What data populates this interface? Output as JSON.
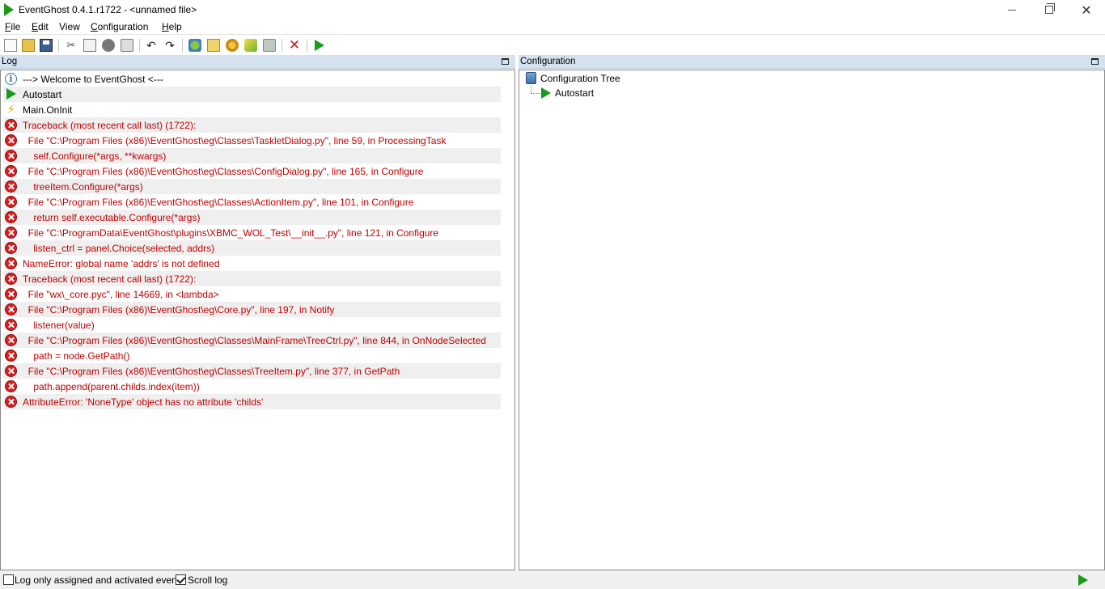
{
  "window": {
    "title": "EventGhost 0.4.1.r1722 - <unnamed file>"
  },
  "menu": [
    {
      "label": "File",
      "mnemonic": "F",
      "rest": "ile"
    },
    {
      "label": "Edit",
      "mnemonic": "E",
      "rest": "dit"
    },
    {
      "label": "View",
      "mnemonic": "",
      "rest": "View"
    },
    {
      "label": "Configuration",
      "mnemonic": "C",
      "rest": "onfiguration"
    },
    {
      "label": "Help",
      "mnemonic": "H",
      "rest": "elp"
    }
  ],
  "toolbar": {
    "icons": [
      "new-icon",
      "open-icon",
      "save-icon",
      "cut-icon",
      "copy-icon",
      "python-icon",
      "paste-icon",
      "undo-icon",
      "redo-icon",
      "add-plugin-icon",
      "add-folder-icon",
      "add-macro-icon",
      "add-event-icon",
      "add-action-icon",
      "disable-icon",
      "execute-icon"
    ],
    "cut_glyph": "✂",
    "undo_glyph": "↶",
    "redo_glyph": "↷",
    "disable_glyph": "✕"
  },
  "log": {
    "title": "Log",
    "rows": [
      {
        "type": "info",
        "text": "---> Welcome to EventGhost <---"
      },
      {
        "type": "play",
        "text": "Autostart"
      },
      {
        "type": "lightning",
        "text": "Main.OnInit"
      },
      {
        "type": "error",
        "text": "Traceback (most recent call last) (1722):"
      },
      {
        "type": "error",
        "text": "  File \"C:\\Program Files (x86)\\EventGhost\\eg\\Classes\\TaskletDialog.py\", line 59, in ProcessingTask"
      },
      {
        "type": "error",
        "text": "    self.Configure(*args, **kwargs)"
      },
      {
        "type": "error",
        "text": "  File \"C:\\Program Files (x86)\\EventGhost\\eg\\Classes\\ConfigDialog.py\", line 165, in Configure"
      },
      {
        "type": "error",
        "text": "    treeItem.Configure(*args)"
      },
      {
        "type": "error",
        "text": "  File \"C:\\Program Files (x86)\\EventGhost\\eg\\Classes\\ActionItem.py\", line 101, in Configure"
      },
      {
        "type": "error",
        "text": "    return self.executable.Configure(*args)"
      },
      {
        "type": "error",
        "text": "  File \"C:\\ProgramData\\EventGhost\\plugins\\XBMC_WOL_Test\\__init__.py\", line 121, in Configure"
      },
      {
        "type": "error",
        "text": "    listen_ctrl = panel.Choice(selected, addrs)"
      },
      {
        "type": "error",
        "text": "NameError: global name 'addrs' is not defined"
      },
      {
        "type": "error",
        "text": "Traceback (most recent call last) (1722):"
      },
      {
        "type": "error",
        "text": "  File \"wx\\_core.pyc\", line 14669, in <lambda>"
      },
      {
        "type": "error",
        "text": "  File \"C:\\Program Files (x86)\\EventGhost\\eg\\Core.py\", line 197, in Notify"
      },
      {
        "type": "error",
        "text": "    listener(value)"
      },
      {
        "type": "error",
        "text": "  File \"C:\\Program Files (x86)\\EventGhost\\eg\\Classes\\MainFrame\\TreeCtrl.py\", line 844, in OnNodeSelected"
      },
      {
        "type": "error",
        "text": "    path = node.GetPath()"
      },
      {
        "type": "error",
        "text": "  File \"C:\\Program Files (x86)\\EventGhost\\eg\\Classes\\TreeItem.py\", line 377, in GetPath"
      },
      {
        "type": "error",
        "text": "    path.append(parent.childs.index(item))"
      },
      {
        "type": "error",
        "text": "AttributeError: 'NoneType' object has no attribute 'childs'"
      }
    ]
  },
  "config": {
    "title": "Configuration",
    "root_label": "Configuration Tree",
    "child_label": "Autostart"
  },
  "status": {
    "log_only_label": "Log only assigned and activated events",
    "log_only_checked": false,
    "scroll_label": "Scroll log",
    "scroll_checked": true
  },
  "colors": {
    "error": "#c00000",
    "accent_green": "#1a9a1a",
    "panel_header": "#d4e2f0"
  }
}
